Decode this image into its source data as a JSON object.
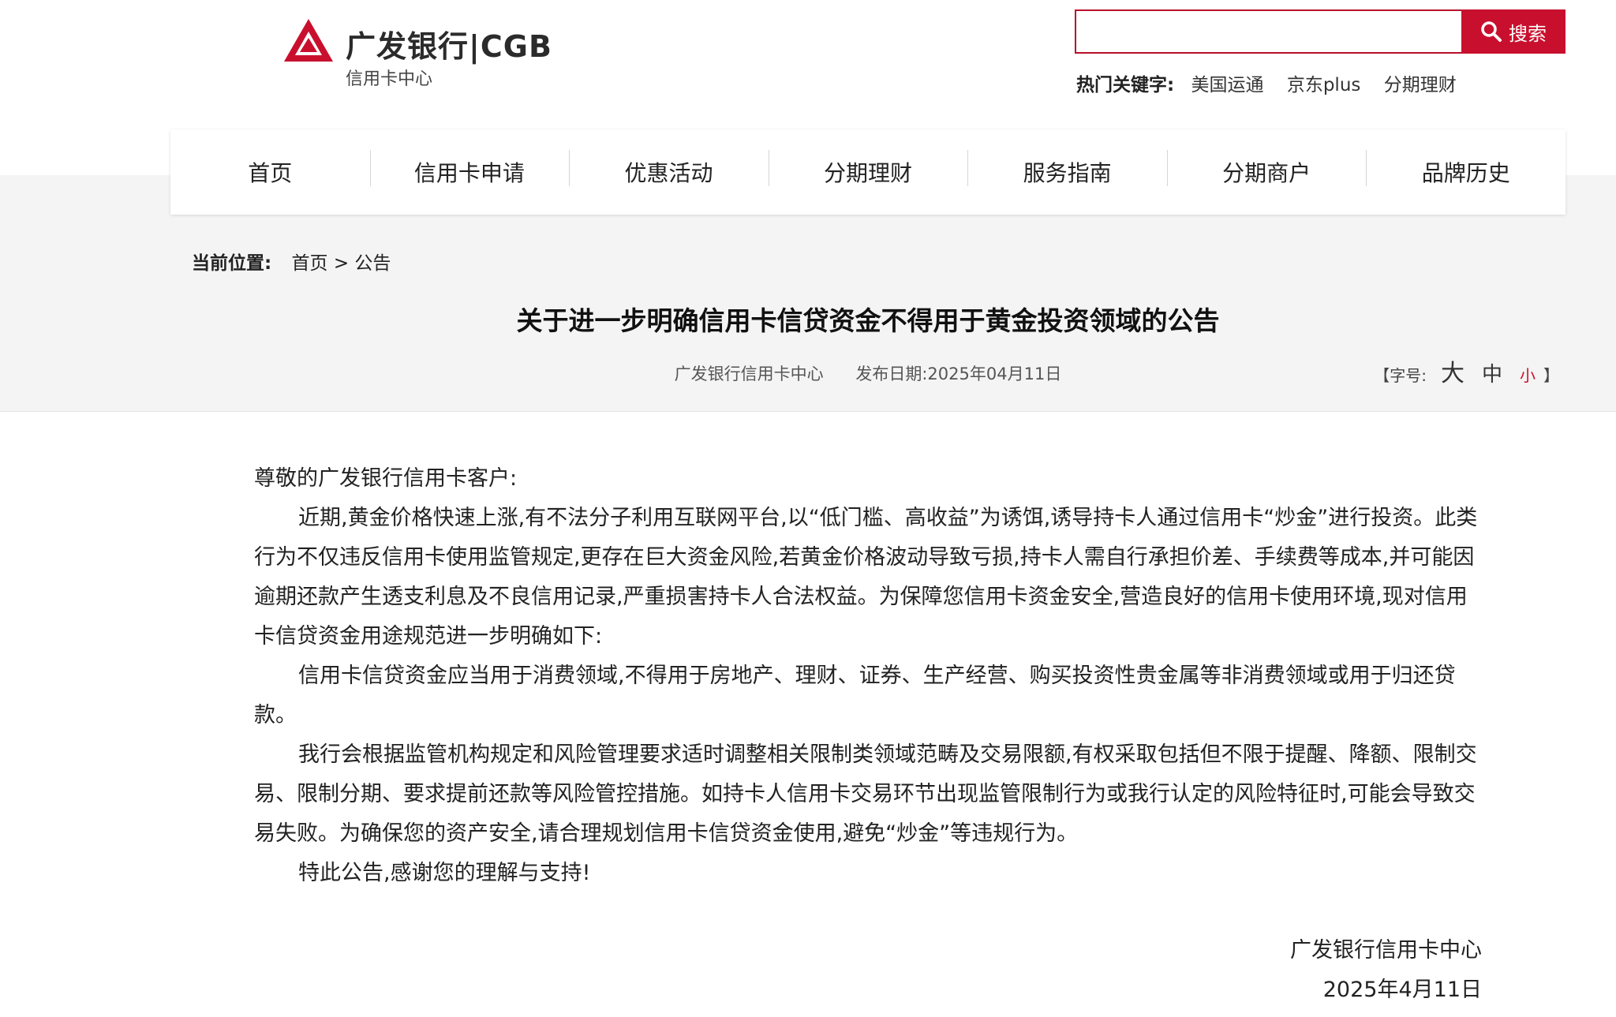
{
  "brand": {
    "name": "广发银行|CGB",
    "subtitle": "信用卡中心",
    "accent_color": "#c8102e"
  },
  "search": {
    "placeholder": "",
    "button_label": "搜索"
  },
  "hot_keywords": {
    "label": "热门关键字:",
    "items": [
      "美国运通",
      "京东plus",
      "分期理财"
    ]
  },
  "nav": {
    "items": [
      "首页",
      "信用卡申请",
      "优惠活动",
      "分期理财",
      "服务指南",
      "分期商户",
      "品牌历史"
    ]
  },
  "breadcrumb": {
    "label": "当前位置:",
    "home": "首页",
    "separator": ">",
    "current": "公告"
  },
  "article": {
    "title": "关于进一步明确信用卡信贷资金不得用于黄金投资领域的公告",
    "source": "广发银行信用卡中心",
    "publish_date": "发布日期:2025年04月11日",
    "font_size": {
      "open": "【字号:",
      "large": "大",
      "medium": "中",
      "small": "小",
      "close": "】"
    },
    "salutation": "尊敬的广发银行信用卡客户:",
    "paragraphs": [
      "近期,黄金价格快速上涨,有不法分子利用互联网平台,以“低门槛、高收益”为诱饵,诱导持卡人通过信用卡“炒金”进行投资。此类行为不仅违反信用卡使用监管规定,更存在巨大资金风险,若黄金价格波动导致亏损,持卡人需自行承担价差、手续费等成本,并可能因逾期还款产生透支利息及不良信用记录,严重损害持卡人合法权益。为保障您信用卡资金安全,营造良好的信用卡使用环境,现对信用卡信贷资金用途规范进一步明确如下:",
      "信用卡信贷资金应当用于消费领域,不得用于房地产、理财、证券、生产经营、购买投资性贵金属等非消费领域或用于归还贷款。",
      "我行会根据监管机构规定和风险管理要求适时调整相关限制类领域范畴及交易限额,有权采取包括但不限于提醒、降额、限制交易、限制分期、要求提前还款等风险管控措施。如持卡人信用卡交易环节出现监管限制行为或我行认定的风险特征时,可能会导致交易失败。为确保您的资产安全,请合理规划信用卡信贷资金使用,避免“炒金”等违规行为。",
      "特此公告,感谢您的理解与支持!"
    ],
    "signature": "广发银行信用卡中心",
    "signature_date": "2025年4月11日"
  }
}
